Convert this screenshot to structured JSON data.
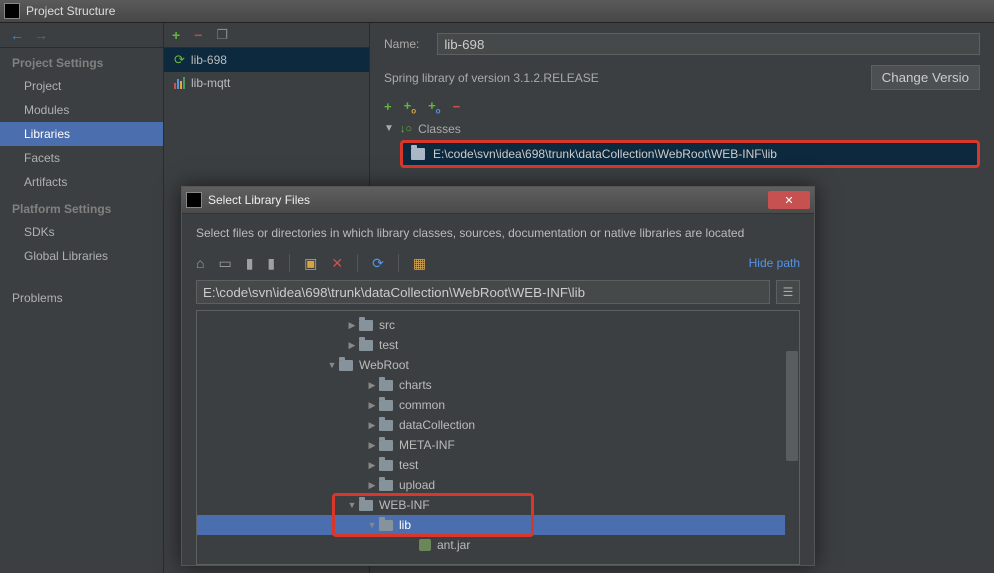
{
  "window": {
    "title": "Project Structure"
  },
  "sidebar": {
    "groups": [
      {
        "title": "Project Settings",
        "items": [
          "Project",
          "Modules",
          "Libraries",
          "Facets",
          "Artifacts"
        ],
        "selectedIndex": 2
      },
      {
        "title": "Platform Settings",
        "items": [
          "SDKs",
          "Global Libraries"
        ]
      },
      {
        "title": "",
        "items": [
          "Problems"
        ]
      }
    ]
  },
  "libList": {
    "items": [
      {
        "name": "lib-698",
        "icon": "spring"
      },
      {
        "name": "lib-mqtt",
        "icon": "bars"
      }
    ],
    "selectedIndex": 0
  },
  "details": {
    "nameLabel": "Name:",
    "nameValue": "lib-698",
    "springInfo": "Spring library of version 3.1.2.RELEASE",
    "changeVersion": "Change Versio",
    "classesLabel": "Classes",
    "classesPath": "E:\\code\\svn\\idea\\698\\trunk\\dataCollection\\WebRoot\\WEB-INF\\lib"
  },
  "dialog": {
    "title": "Select Library Files",
    "desc": "Select files or directories in which library classes, sources, documentation or native libraries are located",
    "hidePath": "Hide path",
    "pathValue": "E:\\code\\svn\\idea\\698\\trunk\\dataCollection\\WebRoot\\WEB-INF\\lib",
    "tree": [
      {
        "indent": 150,
        "tri": "right",
        "type": "folder",
        "label": "src"
      },
      {
        "indent": 150,
        "tri": "right",
        "type": "folder",
        "label": "test"
      },
      {
        "indent": 130,
        "tri": "down",
        "type": "folder",
        "label": "WebRoot"
      },
      {
        "indent": 170,
        "tri": "right",
        "type": "folder",
        "label": "charts"
      },
      {
        "indent": 170,
        "tri": "right",
        "type": "folder",
        "label": "common"
      },
      {
        "indent": 170,
        "tri": "right",
        "type": "folder",
        "label": "dataCollection"
      },
      {
        "indent": 170,
        "tri": "right",
        "type": "folder",
        "label": "META-INF"
      },
      {
        "indent": 170,
        "tri": "right",
        "type": "folder",
        "label": "test"
      },
      {
        "indent": 170,
        "tri": "right",
        "type": "folder",
        "label": "upload"
      },
      {
        "indent": 150,
        "tri": "down",
        "type": "folder",
        "label": "WEB-INF"
      },
      {
        "indent": 170,
        "tri": "down",
        "type": "folder",
        "label": "lib",
        "selected": true
      },
      {
        "indent": 210,
        "tri": "none",
        "type": "jar",
        "label": "ant.jar"
      }
    ]
  }
}
